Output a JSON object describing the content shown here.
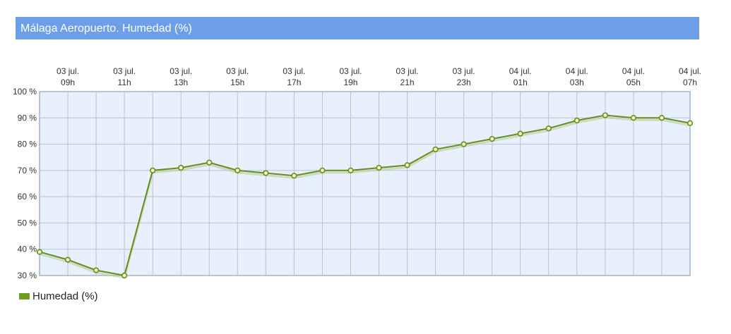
{
  "title": "Málaga Aeropuerto. Humedad (%)",
  "legend": {
    "label": "Humedad (%)"
  },
  "colors": {
    "title_bg": "#6d9fe9",
    "plot_bg": "#e8f0fb",
    "grid": "#b7c3d6",
    "border": "#9fb4d3",
    "line": "#5f9019",
    "point_fill": "#fff7c9",
    "series": "#6b9e1f"
  },
  "chart_data": {
    "type": "line",
    "title": "Málaga Aeropuerto. Humedad (%)",
    "x_tick_labels": [
      [
        "03 jul.",
        "09h"
      ],
      [
        "03 jul.",
        "11h"
      ],
      [
        "03 jul.",
        "13h"
      ],
      [
        "03 jul.",
        "15h"
      ],
      [
        "03 jul.",
        "17h"
      ],
      [
        "03 jul.",
        "19h"
      ],
      [
        "03 jul.",
        "21h"
      ],
      [
        "03 jul.",
        "23h"
      ],
      [
        "04 jul.",
        "01h"
      ],
      [
        "04 jul.",
        "03h"
      ],
      [
        "04 jul.",
        "05h"
      ],
      [
        "04 jul.",
        "07h"
      ]
    ],
    "y_ticks": [
      "100 %",
      "90 %",
      "80 %",
      "70 %",
      "60 %",
      "50 %",
      "40 %",
      "30 %"
    ],
    "ylim": [
      30,
      100
    ],
    "grid": true,
    "legend_position": "bottom-left",
    "series": [
      {
        "name": "Humedad (%)",
        "x": [
          "03 jul. 08h",
          "03 jul. 09h",
          "03 jul. 10h",
          "03 jul. 11h",
          "03 jul. 12h",
          "03 jul. 13h",
          "03 jul. 14h",
          "03 jul. 15h",
          "03 jul. 16h",
          "03 jul. 17h",
          "03 jul. 18h",
          "03 jul. 19h",
          "03 jul. 20h",
          "03 jul. 21h",
          "03 jul. 22h",
          "03 jul. 23h",
          "04 jul. 00h",
          "04 jul. 01h",
          "04 jul. 02h",
          "04 jul. 03h",
          "04 jul. 04h",
          "04 jul. 05h",
          "04 jul. 06h",
          "04 jul. 07h"
        ],
        "values": [
          39,
          36,
          32,
          30,
          70,
          71,
          73,
          70,
          69,
          68,
          70,
          70,
          71,
          72,
          78,
          80,
          82,
          84,
          86,
          89,
          91,
          90,
          90,
          88
        ]
      }
    ]
  }
}
